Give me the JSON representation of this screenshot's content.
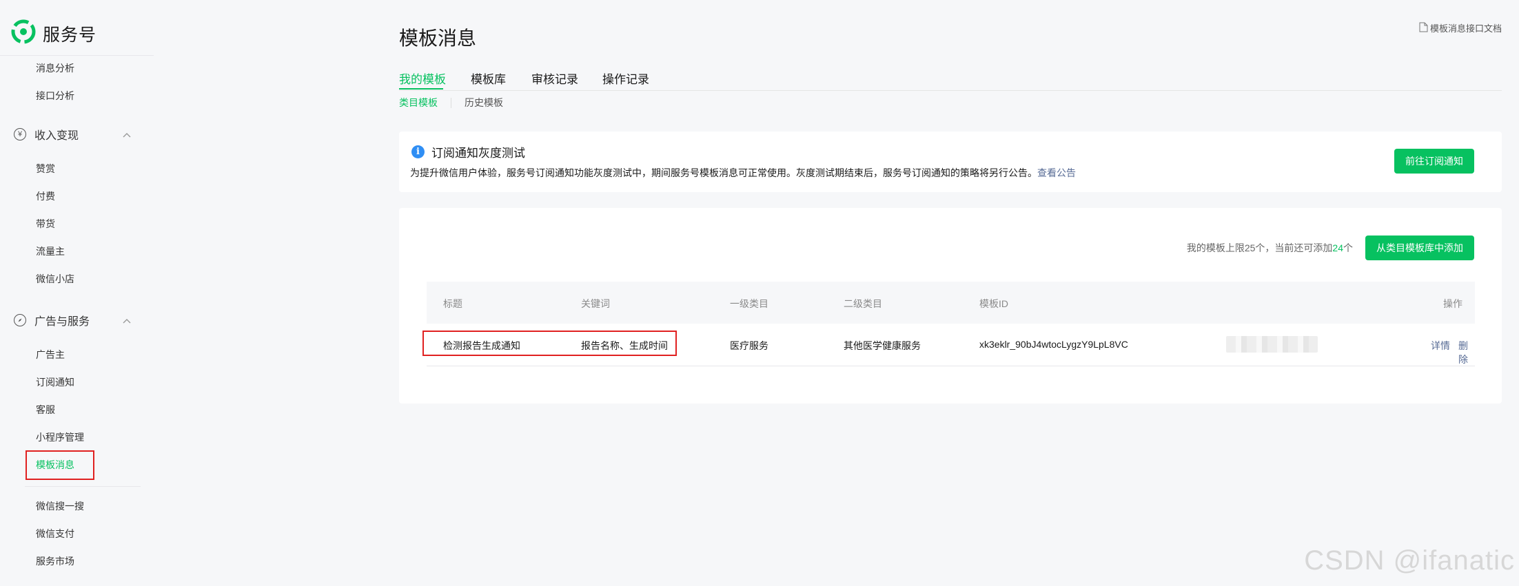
{
  "brand": {
    "title": "服务号"
  },
  "sidebar": {
    "top_items": [
      "消息分析",
      "接口分析"
    ],
    "group_income": {
      "label": "收入变现",
      "icon": "yen-circle-icon",
      "items": [
        "赞赏",
        "付费",
        "带货",
        "流量主",
        "微信小店"
      ]
    },
    "group_ads": {
      "label": "广告与服务",
      "icon": "compass-icon",
      "items": [
        "广告主",
        "订阅通知",
        "客服",
        "小程序管理",
        "模板消息"
      ]
    },
    "bottom_items": [
      "微信搜一搜",
      "微信支付",
      "服务市场"
    ],
    "active_item": "模板消息"
  },
  "header": {
    "title": "模板消息",
    "doc_link": "模板消息接口文档"
  },
  "tabs": [
    {
      "label": "我的模板",
      "active": true
    },
    {
      "label": "模板库",
      "active": false
    },
    {
      "label": "审核记录",
      "active": false
    },
    {
      "label": "操作记录",
      "active": false
    }
  ],
  "subtabs": [
    {
      "label": "类目模板",
      "active": true
    },
    {
      "label": "历史模板",
      "active": false
    }
  ],
  "notice": {
    "title": "订阅通知灰度测试",
    "text": "为提升微信用户体验，服务号订阅通知功能灰度测试中，期间服务号模板消息可正常使用。灰度测试期结束后，服务号订阅通知的策略将另行公告。",
    "link": "查看公告",
    "button": "前往订阅通知"
  },
  "template_list": {
    "quota_prefix": "我的模板上限25个，当前还可添加",
    "quota_remaining": "24",
    "quota_suffix": "个",
    "add_button": "从类目模板库中添加",
    "columns": [
      "标题",
      "关键词",
      "一级类目",
      "二级类目",
      "模板ID",
      "操作"
    ],
    "rows": [
      {
        "title": "检测报告生成通知",
        "keywords": "报告名称、生成时间",
        "primary_category": "医疗服务",
        "secondary_category": "其他医学健康服务",
        "template_id": "xk3eklr_90bJ4wtocLygzY9LpL8VC",
        "actions": [
          "详情",
          "删除"
        ]
      }
    ]
  },
  "watermark": "CSDN @ifanatic",
  "colors": {
    "accent": "#07c160",
    "link": "#576b95",
    "highlight": "#e02020",
    "info": "#2f8ef4"
  }
}
